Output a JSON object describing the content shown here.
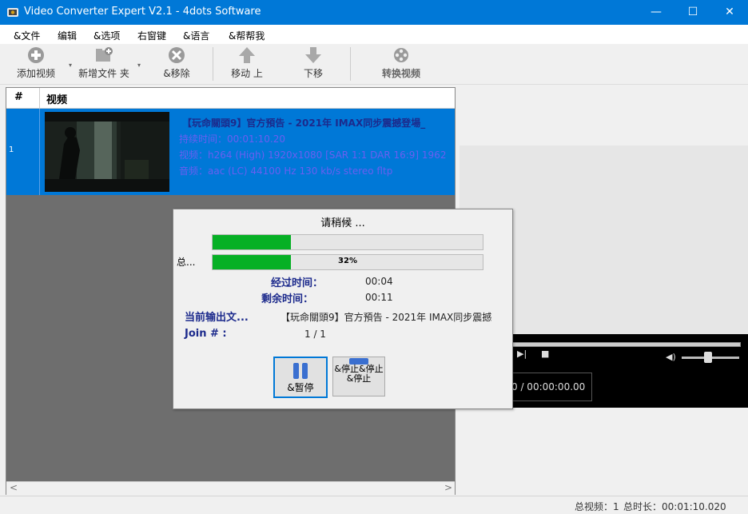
{
  "window": {
    "title": "Video Converter Expert V2.1 - 4dots Software",
    "minimize": "—",
    "maximize": "☐",
    "close": "✕"
  },
  "menu": [
    "&文件",
    "编辑",
    "&选项",
    "右窗键",
    "&语言",
    "&帮帮我"
  ],
  "toolbar": {
    "add_video": "添加视频",
    "add_folder": "新增文件 夹",
    "remove": "&移除",
    "move_up": "移动 上",
    "move_down": "下移",
    "convert": "转换视频"
  },
  "list": {
    "col_num": "#",
    "col_video": "视频",
    "rows": [
      {
        "num": "1",
        "title": "【玩命關頭9】官方預告 - 2021年 IMAX同步震撼登場_",
        "duration": "持续时间：00:01:10.20",
        "video": "视频：h264 (High) 1920x1080 [SAR 1:1 DAR 16:9] 1962",
        "audio": "音频：aac (LC) 44100 Hz 130 kb/s stereo fltp"
      }
    ]
  },
  "player": {
    "time": "0 / 00:00:00.00"
  },
  "status": {
    "total_videos": "总视频：1",
    "total_duration": "总时长：00:01:10.020"
  },
  "dialog": {
    "title": "请稍候 ...",
    "file_progress": 0.29,
    "total_label": "总...",
    "total_progress": 0.29,
    "total_pct": "32%",
    "elapsed_label": "经过时间：",
    "elapsed_value": "00:04",
    "remaining_label": "剩余时间：",
    "remaining_value": "00:11",
    "output_label": "当前输出文...",
    "output_value": "【玩命關頭9】官方預告 - 2021年 IMAX同步震撼",
    "join_label": "Join # :",
    "join_value": "1 / 1",
    "pause": "&暂停",
    "stop": "&停止&停止&停止"
  },
  "colors": {
    "titlebar": "#0078d7",
    "selection": "#0078d7",
    "progress": "#06b025",
    "label_blue": "#1c2a8c"
  }
}
